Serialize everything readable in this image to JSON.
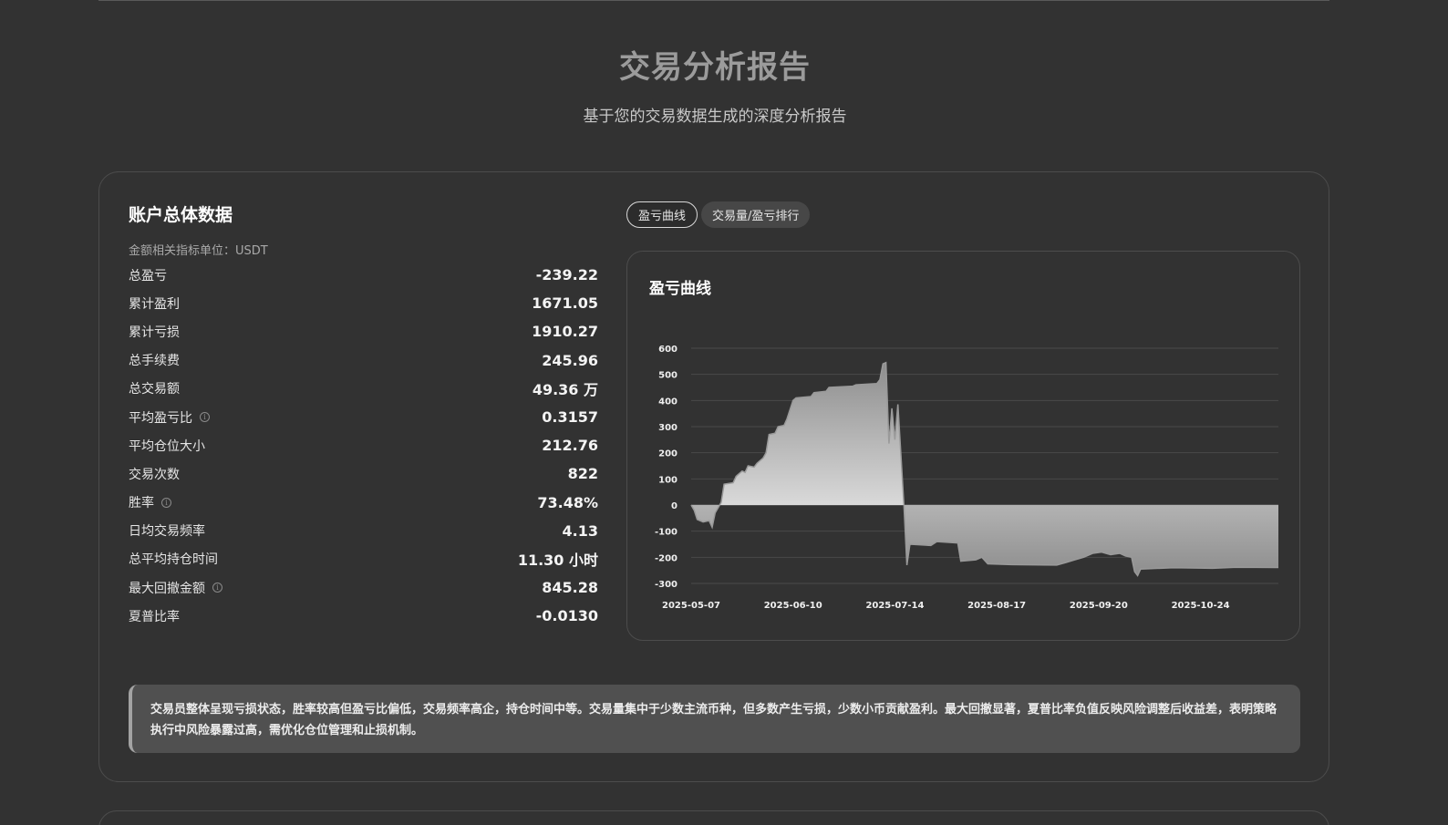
{
  "header": {
    "title": "交易分析报告",
    "subtitle": "基于您的交易数据生成的深度分析报告"
  },
  "account": {
    "title": "账户总体数据",
    "unit_note": "金额相关指标单位：USDT",
    "metrics": [
      {
        "label": "总盈亏",
        "value": "-239.22",
        "info": false
      },
      {
        "label": "累计盈利",
        "value": "1671.05",
        "info": false
      },
      {
        "label": "累计亏损",
        "value": "1910.27",
        "info": false
      },
      {
        "label": "总手续费",
        "value": "245.96",
        "info": false
      },
      {
        "label": "总交易额",
        "value": "49.36 万",
        "info": false
      },
      {
        "label": "平均盈亏比",
        "value": "0.3157",
        "info": true
      },
      {
        "label": "平均仓位大小",
        "value": "212.76",
        "info": false
      },
      {
        "label": "交易次数",
        "value": "822",
        "info": false
      },
      {
        "label": "胜率",
        "value": "73.48%",
        "info": true
      },
      {
        "label": "日均交易频率",
        "value": "4.13",
        "info": false
      },
      {
        "label": "总平均持仓时间",
        "value": "11.30 小时",
        "info": false
      },
      {
        "label": "最大回撤金额",
        "value": "845.28",
        "info": true
      },
      {
        "label": "夏普比率",
        "value": "-0.0130",
        "info": false
      }
    ]
  },
  "tabs": [
    {
      "label": "盈亏曲线",
      "active": true
    },
    {
      "label": "交易量/盈亏排行",
      "active": false
    }
  ],
  "chart_card": {
    "title": "盈亏曲线"
  },
  "chart_data": {
    "type": "area",
    "title": "盈亏曲线",
    "xlabel": "",
    "ylabel": "",
    "x_ticks": [
      "2025-05-07",
      "2025-06-10",
      "2025-07-14",
      "2025-08-17",
      "2025-09-20",
      "2025-10-24"
    ],
    "y_ticks": [
      600,
      500,
      400,
      300,
      200,
      100,
      0,
      -100,
      -200,
      -300
    ],
    "ylim": [
      -300,
      600
    ],
    "xlim": [
      "2025-05-07",
      "2025-11-19"
    ],
    "grid": true,
    "series": [
      {
        "points": [
          [
            "2025-05-07",
            0
          ],
          [
            "2025-05-08",
            -20
          ],
          [
            "2025-05-09",
            -55
          ],
          [
            "2025-05-11",
            -65
          ],
          [
            "2025-05-13",
            -60
          ],
          [
            "2025-05-14",
            -85
          ],
          [
            "2025-05-15",
            -30
          ],
          [
            "2025-05-17",
            10
          ],
          [
            "2025-05-18",
            80
          ],
          [
            "2025-05-21",
            85
          ],
          [
            "2025-05-22",
            110
          ],
          [
            "2025-05-24",
            130
          ],
          [
            "2025-05-25",
            125
          ],
          [
            "2025-05-26",
            150
          ],
          [
            "2025-05-28",
            145
          ],
          [
            "2025-05-29",
            160
          ],
          [
            "2025-05-31",
            180
          ],
          [
            "2025-06-01",
            200
          ],
          [
            "2025-06-02",
            270
          ],
          [
            "2025-06-04",
            275
          ],
          [
            "2025-06-05",
            300
          ],
          [
            "2025-06-07",
            305
          ],
          [
            "2025-06-08",
            330
          ],
          [
            "2025-06-10",
            400
          ],
          [
            "2025-06-11",
            410
          ],
          [
            "2025-06-16",
            415
          ],
          [
            "2025-06-17",
            430
          ],
          [
            "2025-06-21",
            435
          ],
          [
            "2025-06-22",
            450
          ],
          [
            "2025-06-30",
            455
          ],
          [
            "2025-07-01",
            460
          ],
          [
            "2025-07-08",
            465
          ],
          [
            "2025-07-09",
            480
          ],
          [
            "2025-07-10",
            540
          ],
          [
            "2025-07-11",
            545
          ],
          [
            "2025-07-12",
            235
          ],
          [
            "2025-07-13",
            370
          ],
          [
            "2025-07-14",
            250
          ],
          [
            "2025-07-15",
            385
          ],
          [
            "2025-07-17",
            0
          ],
          [
            "2025-07-18",
            -230
          ],
          [
            "2025-07-19",
            -150
          ],
          [
            "2025-07-26",
            -155
          ],
          [
            "2025-07-28",
            -140
          ],
          [
            "2025-08-04",
            -145
          ],
          [
            "2025-08-05",
            -215
          ],
          [
            "2025-08-10",
            -210
          ],
          [
            "2025-08-12",
            -200
          ],
          [
            "2025-08-14",
            -225
          ],
          [
            "2025-08-22",
            -228
          ],
          [
            "2025-09-06",
            -230
          ],
          [
            "2025-09-09",
            -220
          ],
          [
            "2025-09-12",
            -210
          ],
          [
            "2025-09-15",
            -200
          ],
          [
            "2025-09-18",
            -185
          ],
          [
            "2025-09-21",
            -180
          ],
          [
            "2025-09-24",
            -190
          ],
          [
            "2025-09-27",
            -185
          ],
          [
            "2025-09-29",
            -195
          ],
          [
            "2025-10-01",
            -200
          ],
          [
            "2025-10-02",
            -255
          ],
          [
            "2025-10-03",
            -270
          ],
          [
            "2025-10-04",
            -245
          ],
          [
            "2025-10-15",
            -240
          ],
          [
            "2025-10-28",
            -242
          ],
          [
            "2025-11-05",
            -238
          ],
          [
            "2025-11-19",
            -239
          ]
        ]
      }
    ]
  },
  "summary": {
    "text": "交易员整体呈现亏损状态，胜率较高但盈亏比偏低，交易频率高企，持仓时间中等。交易量集中于少数主流币种，但多数产生亏损，少数小币贡献盈利。最大回撤显著，夏普比率负值反映风险调整后收益差，表明策略执行中风险暴露过高，需优化仓位管理和止损机制。"
  },
  "colors": {
    "background": "#323232",
    "card_border": "#4c4c4c",
    "title_gray": "#9b9b9b",
    "summary_bg": "#505050"
  }
}
